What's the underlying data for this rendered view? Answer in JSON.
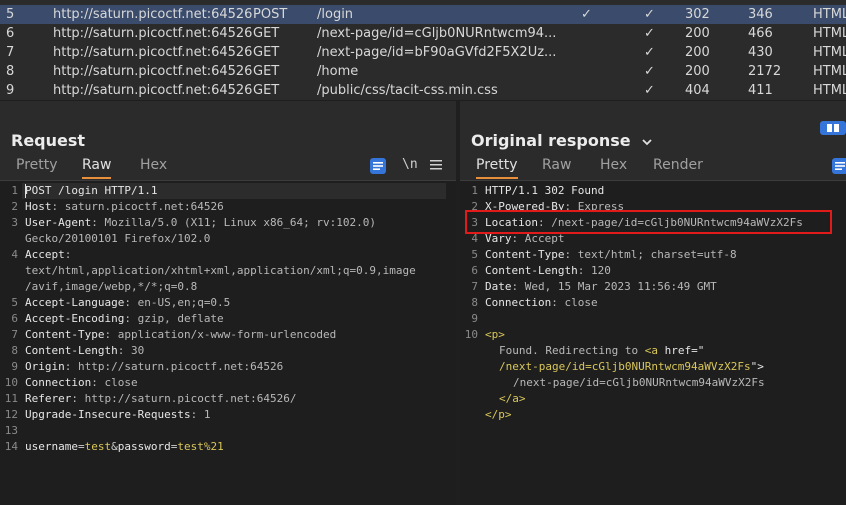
{
  "history": {
    "partial_top": [
      "",
      "",
      "",
      "/ ... /"
    ],
    "rows": [
      {
        "num": "5",
        "host": "http://saturn.picoctf.net:64526",
        "method": "POST",
        "url": "/login",
        "edited": "✓",
        "params": "✓",
        "status": "302",
        "length": "346",
        "mime": "HTML",
        "selected": true
      },
      {
        "num": "6",
        "host": "http://saturn.picoctf.net:64526",
        "method": "GET",
        "url": "/next-page/id=cGljb0NURntwcm94...",
        "edited": "",
        "params": "✓",
        "status": "200",
        "length": "466",
        "mime": "HTML"
      },
      {
        "num": "7",
        "host": "http://saturn.picoctf.net:64526",
        "method": "GET",
        "url": "/next-page/id=bF90aGVfd2F5X2Uz...",
        "edited": "",
        "params": "✓",
        "status": "200",
        "length": "430",
        "mime": "HTML"
      },
      {
        "num": "8",
        "host": "http://saturn.picoctf.net:64526",
        "method": "GET",
        "url": "/home",
        "edited": "",
        "params": "✓",
        "status": "200",
        "length": "2172",
        "mime": "HTML"
      },
      {
        "num": "9",
        "host": "http://saturn.picoctf.net:64526",
        "method": "GET",
        "url": "/public/css/tacit-css.min.css",
        "edited": "",
        "params": "✓",
        "status": "404",
        "length": "411",
        "mime": "HTML"
      }
    ]
  },
  "request": {
    "title": "Request",
    "tabs": [
      "Pretty",
      "Raw",
      "Hex"
    ],
    "active_tab": "Raw",
    "newline_toggle": "\\n",
    "lines": [
      {
        "n": "1",
        "k": "POST /login HTTP/1.1",
        "v": ""
      },
      {
        "n": "2",
        "k": "Host",
        "v": ": saturn.picoctf.net:64526"
      },
      {
        "n": "3",
        "k": "User-Agent",
        "v": ": Mozilla/5.0 (X11; Linux x86_64; rv:102.0)"
      },
      {
        "n": "",
        "k": "",
        "v": "Gecko/20100101 Firefox/102.0"
      },
      {
        "n": "4",
        "k": "Accept",
        "v": ":"
      },
      {
        "n": "",
        "k": "",
        "v": "text/html,application/xhtml+xml,application/xml;q=0.9,image"
      },
      {
        "n": "",
        "k": "",
        "v": "/avif,image/webp,*/*;q=0.8"
      },
      {
        "n": "5",
        "k": "Accept-Language",
        "v": ": en-US,en;q=0.5"
      },
      {
        "n": "6",
        "k": "Accept-Encoding",
        "v": ": gzip, deflate"
      },
      {
        "n": "7",
        "k": "Content-Type",
        "v": ": application/x-www-form-urlencoded"
      },
      {
        "n": "8",
        "k": "Content-Length",
        "v": ": 30"
      },
      {
        "n": "9",
        "k": "Origin",
        "v": ": http://saturn.picoctf.net:64526"
      },
      {
        "n": "10",
        "k": "Connection",
        "v": ": close"
      },
      {
        "n": "11",
        "k": "Referer",
        "v": ": http://saturn.picoctf.net:64526/"
      },
      {
        "n": "12",
        "k": "Upgrade-Insecure-Requests",
        "v": ": 1"
      },
      {
        "n": "13",
        "k": "",
        "v": ""
      }
    ],
    "body_line": {
      "n": "14",
      "p1": "username",
      "e1": "=",
      "v1": "test",
      "amp": "&",
      "p2": "password",
      "e2": "=",
      "v2": "test%21"
    }
  },
  "response": {
    "title": "Original response",
    "tabs": [
      "Pretty",
      "Raw",
      "Hex",
      "Render"
    ],
    "active_tab": "Pretty",
    "lines": [
      {
        "n": "1",
        "k": "HTTP/1.1 302 Found",
        "v": ""
      },
      {
        "n": "2",
        "k": "X-Powered-By",
        "v": ": Express"
      },
      {
        "n": "3",
        "k": "Location",
        "v": ": /next-page/id=cGljb0NURntwcm94aWVzX2Fs"
      },
      {
        "n": "4",
        "k": "Vary",
        "v": ": Accept"
      },
      {
        "n": "5",
        "k": "Content-Type",
        "v": ": text/html; charset=utf-8"
      },
      {
        "n": "6",
        "k": "Content-Length",
        "v": ": 120"
      },
      {
        "n": "7",
        "k": "Date",
        "v": ": Wed, 15 Mar 2023 11:56:49 GMT"
      },
      {
        "n": "8",
        "k": "Connection",
        "v": ": close"
      },
      {
        "n": "9",
        "k": "",
        "v": ""
      }
    ],
    "html": {
      "n": "10",
      "p_open": "<p>",
      "found": "Found. Redirecting to ",
      "a_open": "<a",
      "href_attr": " href=\"",
      "href_val": "/next-page/id=cGljb0NURntwcm94aWVzX2Fs",
      "href_close": "\">",
      "link_text": "/next-page/id=cGljb0NURntwcm94aWVzX2Fs",
      "a_close": "</a>",
      "p_close": "</p>"
    }
  }
}
